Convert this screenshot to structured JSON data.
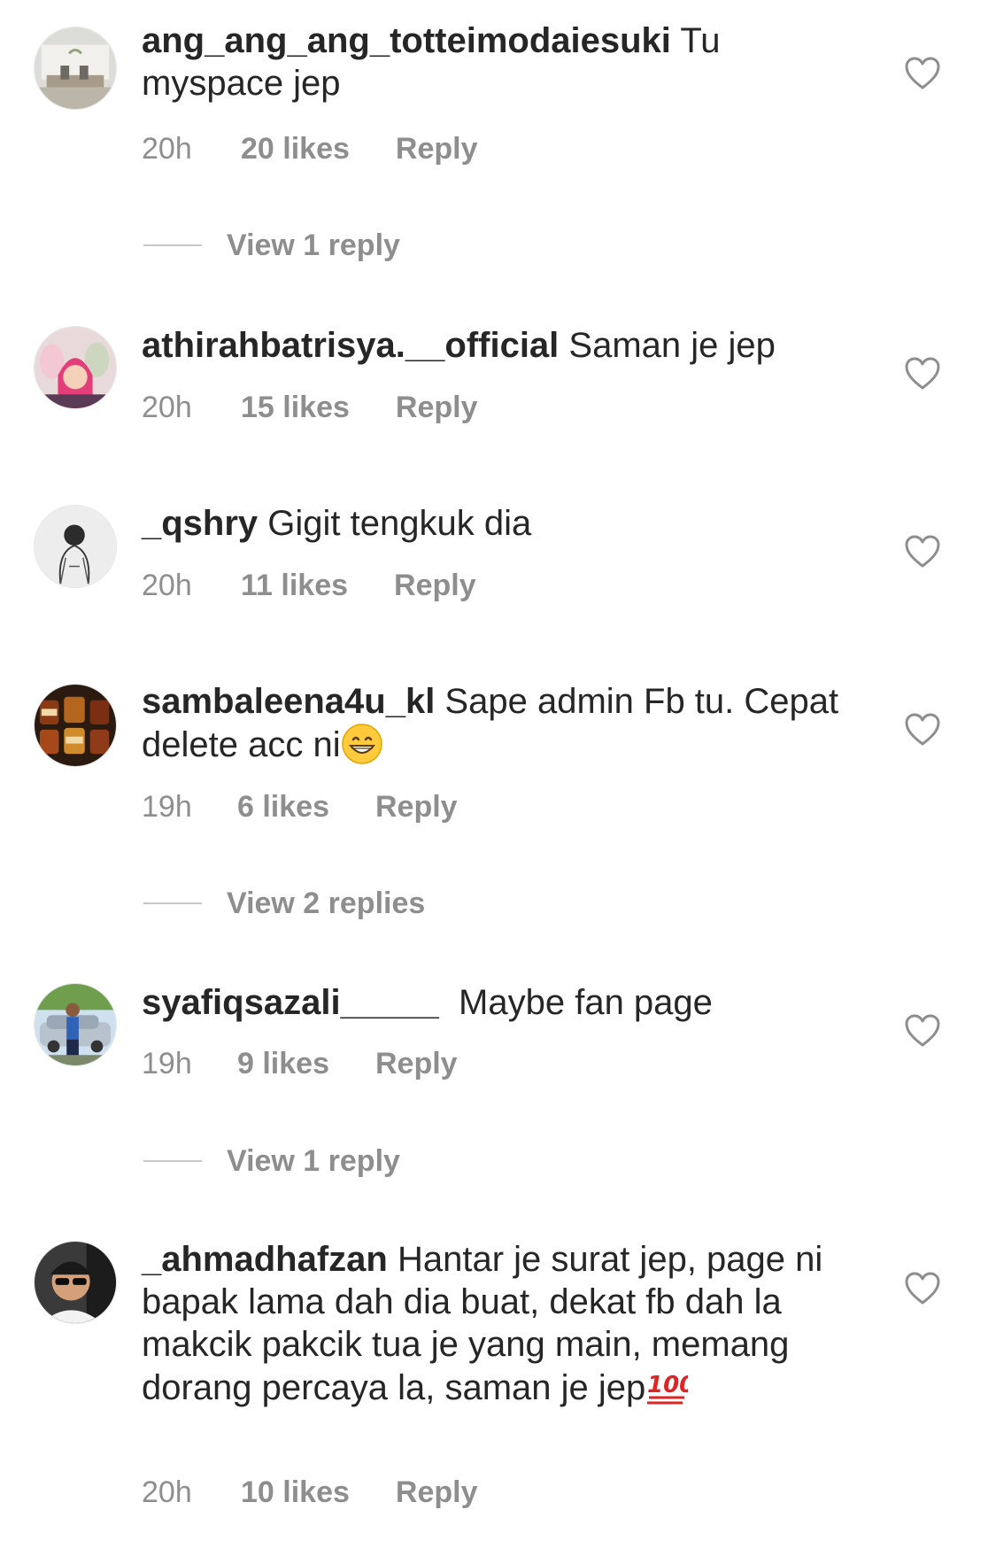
{
  "comments": [
    {
      "username": "ang_ang_ang_totteimodaiesuki",
      "text": " Tu myspace jep",
      "time": "20h",
      "likes": "20 likes",
      "reply": "Reply",
      "view_replies": "View 1 reply"
    },
    {
      "username": "athirahbatrisya.__official",
      "text": " Saman je jep",
      "time": "20h",
      "likes": "15 likes",
      "reply": "Reply"
    },
    {
      "username": "_qshry",
      "text": " Gigit tengkuk dia",
      "time": "20h",
      "likes": "11 likes",
      "reply": "Reply"
    },
    {
      "username": "sambaleena4u_kl",
      "text": " Sape admin Fb tu. Cepat delete acc ni",
      "time": "19h",
      "likes": "6 likes",
      "reply": "Reply",
      "view_replies": "View 2 replies"
    },
    {
      "username": "syafiqsazali_____",
      "text": "  Maybe fan page",
      "time": "19h",
      "likes": "9 likes",
      "reply": "Reply",
      "view_replies": "View 1 reply"
    },
    {
      "username": "_ahmadhafzan",
      "text": " Hantar je surat jep, page ni bapak lama dah dia buat, dekat fb dah la makcik pakcik tua je yang main, memang dorang percaya la, saman je jep",
      "time": "20h",
      "likes": "10 likes",
      "reply": "Reply"
    }
  ],
  "icons": {
    "like": "heart-outline-icon",
    "grin_emoji": "grinning-face-emoji",
    "hundred_emoji": "hundred-points-emoji"
  },
  "colors": {
    "text": "#262626",
    "secondary": "#8e8e8e",
    "divider": "#c7c7c7"
  }
}
